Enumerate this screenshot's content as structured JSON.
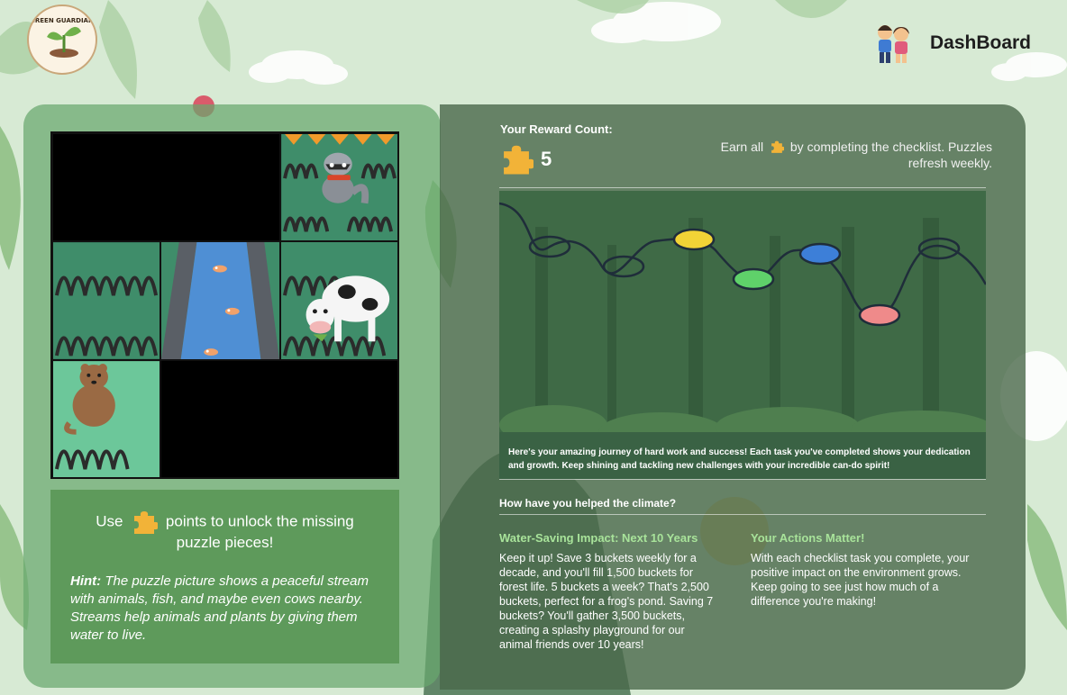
{
  "header": {
    "logo_text": "GREEN GUARDIANS",
    "dashboard_label": "DashBoard"
  },
  "puzzle": {
    "unlock_prefix": "Use",
    "unlock_suffix": "points to unlock the missing",
    "unlock_line2": "puzzle pieces!",
    "hint_label": "Hint:",
    "hint_text": " The puzzle picture shows a peaceful stream with animals, fish, and maybe even cows nearby. Streams help animals and plants by giving them water to live.",
    "tiles": [
      {
        "id": "r1c1",
        "state": "missing"
      },
      {
        "id": "r1c2",
        "state": "missing"
      },
      {
        "id": "r1c3",
        "state": "revealed",
        "content": "raccoon"
      },
      {
        "id": "r2c1",
        "state": "revealed",
        "content": "grass"
      },
      {
        "id": "r2c2",
        "state": "revealed",
        "content": "stream-fish"
      },
      {
        "id": "r2c3",
        "state": "revealed",
        "content": "cow"
      },
      {
        "id": "r3c1",
        "state": "revealed",
        "content": "quokka"
      },
      {
        "id": "r3c2",
        "state": "missing"
      },
      {
        "id": "r3c3",
        "state": "missing"
      }
    ]
  },
  "rewards": {
    "title": "Your Reward Count:",
    "count": "5",
    "earn_prefix": "Earn all",
    "earn_suffix": "by completing the checklist. Puzzles refresh weekly."
  },
  "journey": {
    "caption": "Here's your amazing journey of hard work and success! Each task you've completed shows your dedication and growth. Keep shining and tackling new challenges with your incredible can-do spirit!",
    "nodes": [
      {
        "color": "",
        "status": "empty"
      },
      {
        "color": "",
        "status": "empty"
      },
      {
        "color": "#f2d336",
        "status": "done"
      },
      {
        "color": "#5fd16a",
        "status": "done"
      },
      {
        "color": "#3d7fd8",
        "status": "done"
      },
      {
        "color": "#ef8a8a",
        "status": "done"
      },
      {
        "color": "",
        "status": "empty"
      }
    ]
  },
  "climate": {
    "question": "How have you helped the climate?",
    "water": {
      "title": "Water-Saving Impact: Next 10 Years",
      "text": "Keep it up! Save 3 buckets weekly for a decade, and you'll fill 1,500 buckets for forest life. 5 buckets a week? That's 2,500 buckets, perfect for a frog's pond. Saving 7 buckets? You'll gather 3,500 buckets, creating a splashy playground for our animal friends over 10 years!"
    },
    "actions": {
      "title": "Your Actions Matter!",
      "text": "With each checklist task you complete, your positive impact on the environment grows. Keep going to see just how much of a difference you're making!"
    }
  },
  "colors": {
    "accent_green": "#a8e39a",
    "puzzle_piece": "#f2b338",
    "left_panel": "#68a86e",
    "right_panel": "#4a684a"
  }
}
